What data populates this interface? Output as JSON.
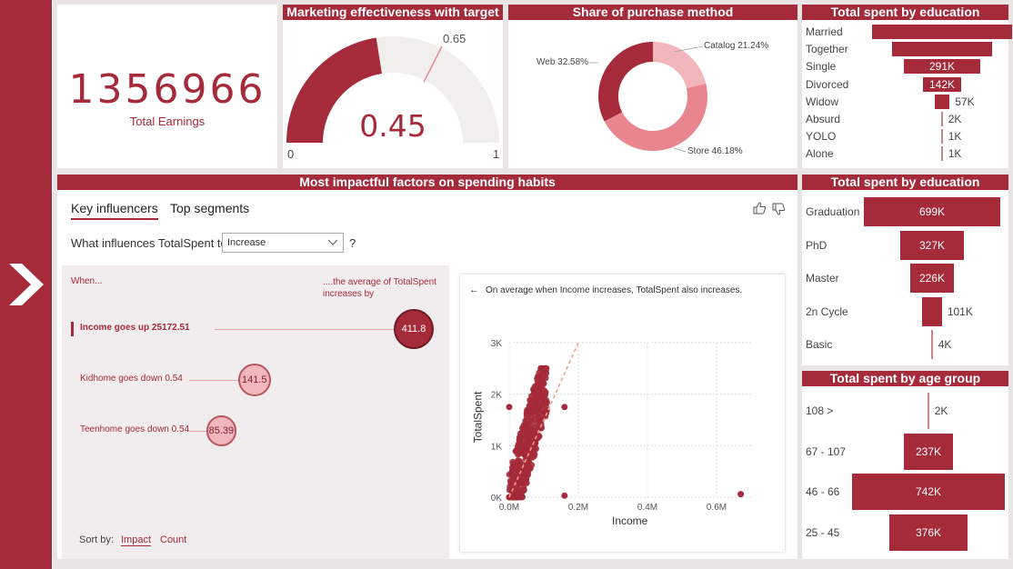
{
  "sidebar": {
    "icon": "chevron-right-icon"
  },
  "kpi": {
    "value": "1356966",
    "label": "Total Earnings"
  },
  "gauge": {
    "title": "Marketing effectiveness with target",
    "value": 0.45,
    "value_label": "0.45",
    "target": 0.65,
    "target_label": "0.65",
    "min_label": "0",
    "max_label": "1"
  },
  "donut": {
    "title": "Share of purchase method",
    "slices": [
      {
        "label": "Catalog 21.24%",
        "value": 21.24,
        "color": "#f2b7bb"
      },
      {
        "label": "Store 46.18%",
        "value": 46.18,
        "color": "#e8858e"
      },
      {
        "label": "Web 32.58%",
        "value": 32.58,
        "color": "#a52a3a"
      }
    ]
  },
  "marital": {
    "title": "Total spent by education",
    "items": [
      {
        "label": "Married",
        "value": "",
        "amount": 530
      },
      {
        "label": "Together",
        "value": "",
        "amount": 380
      },
      {
        "label": "Single",
        "value": "291K",
        "amount": 291
      },
      {
        "label": "Divorced",
        "value": "142K",
        "amount": 142
      },
      {
        "label": "Widow",
        "value": "57K",
        "amount": 57
      },
      {
        "label": "Absurd",
        "value": "2K",
        "amount": 2
      },
      {
        "label": "YOLO",
        "value": "1K",
        "amount": 1
      },
      {
        "label": "Alone",
        "value": "1K",
        "amount": 1
      }
    ]
  },
  "education": {
    "title": "Total spent by education",
    "items": [
      {
        "label": "Graduation",
        "value": "699K",
        "amount": 699
      },
      {
        "label": "PhD",
        "value": "327K",
        "amount": 327
      },
      {
        "label": "Master",
        "value": "226K",
        "amount": 226
      },
      {
        "label": "2n Cycle",
        "value": "101K",
        "amount": 101
      },
      {
        "label": "Basic",
        "value": "4K",
        "amount": 4
      }
    ]
  },
  "age": {
    "title": "Total spent by age group",
    "items": [
      {
        "label": "108 >",
        "value": "2K",
        "amount": 2
      },
      {
        "label": "67 - 107",
        "value": "237K",
        "amount": 237
      },
      {
        "label": "46 - 66",
        "value": "742K",
        "amount": 742
      },
      {
        "label": "25 - 45",
        "value": "376K",
        "amount": 376
      }
    ]
  },
  "influencers": {
    "title": "Most impactful factors on spending habits",
    "tabs": [
      "Key influencers",
      "Top segments"
    ],
    "question_prefix": "What influences TotalSpent to",
    "question_suffix": "?",
    "dropdown_value": "Increase",
    "when_label": "When...",
    "avg_label": "....the average of TotalSpent increases by",
    "factors": [
      {
        "label": "Income goes up 25172.51",
        "value": "411.8",
        "amount": 411.8
      },
      {
        "label": "Kidhome goes down 0.54",
        "value": "141.5",
        "amount": 141.5
      },
      {
        "label": "Teenhome goes down 0.54",
        "value": "85.39",
        "amount": 85.39
      }
    ],
    "sort_label": "Sort by:",
    "sort_options": [
      "Impact",
      "Count"
    ],
    "scatter_caption": "On average when Income increases, TotalSpent also increases."
  },
  "chart_data": {
    "type": "scatter",
    "title": "",
    "xlabel": "Income",
    "ylabel": "TotalSpent",
    "xlim": [
      0,
      0.7
    ],
    "ylim": [
      0,
      3000
    ],
    "x_ticks": [
      "0.0M",
      "0.2M",
      "0.4M",
      "0.6M"
    ],
    "y_ticks": [
      "0K",
      "1K",
      "2K",
      "3K"
    ],
    "trend": {
      "x0": 0,
      "y0": -50,
      "x1": 0.2,
      "y1": 3000
    },
    "outliers": [
      {
        "x": 0.0,
        "y": 1750
      },
      {
        "x": 0.16,
        "y": 1750
      },
      {
        "x": 0.16,
        "y": 30
      },
      {
        "x": 0.67,
        "y": 60
      }
    ],
    "cluster": {
      "x_range": [
        0.0,
        0.11
      ],
      "y_range": [
        0,
        2500
      ]
    }
  }
}
